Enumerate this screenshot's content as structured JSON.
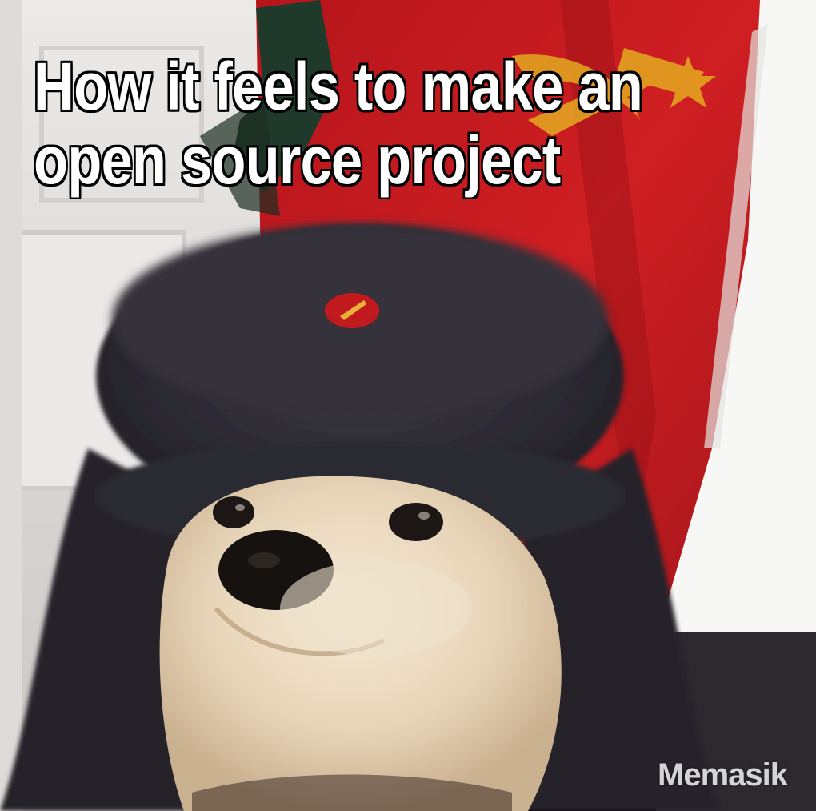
{
  "caption": {
    "line1": "How it feels to make an",
    "line2": "open source project"
  },
  "watermark": "Memasik",
  "colors": {
    "flag_red": "#c8191e",
    "hat_fur": "#2f2d35",
    "dog_fur": "#e9d9c2",
    "wall": "#e7e4e2",
    "window_light": "#f7f7f5"
  }
}
